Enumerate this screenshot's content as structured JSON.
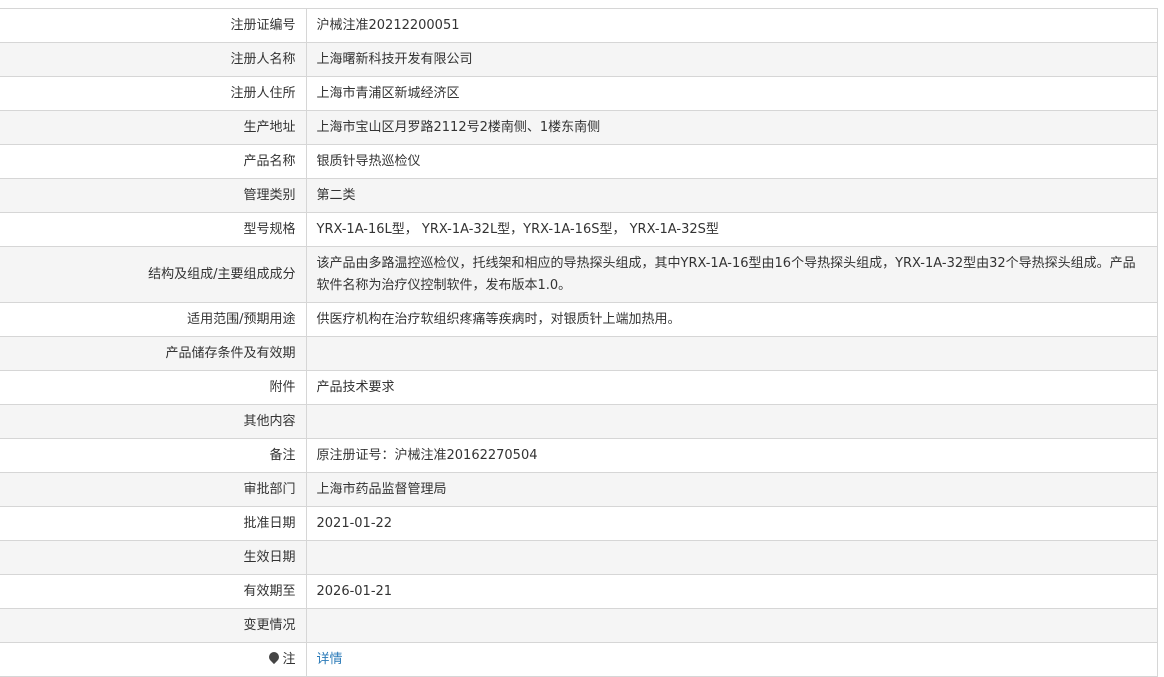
{
  "rows": [
    {
      "label": "注册证编号",
      "value": "沪械注准20212200051"
    },
    {
      "label": "注册人名称",
      "value": "上海曙新科技开发有限公司"
    },
    {
      "label": "注册人住所",
      "value": "上海市青浦区新城经济区"
    },
    {
      "label": "生产地址",
      "value": "上海市宝山区月罗路2112号2楼南侧、1楼东南侧"
    },
    {
      "label": "产品名称",
      "value": "银质针导热巡检仪"
    },
    {
      "label": "管理类别",
      "value": "第二类"
    },
    {
      "label": "型号规格",
      "value": "YRX-1A-16L型， YRX-1A-32L型，YRX-1A-16S型， YRX-1A-32S型"
    },
    {
      "label": "结构及组成/主要组成成分",
      "value": "该产品由多路温控巡检仪，托线架和相应的导热探头组成，其中YRX-1A-16型由16个导热探头组成，YRX-1A-32型由32个导热探头组成。产品软件名称为治疗仪控制软件，发布版本1.0。"
    },
    {
      "label": "适用范围/预期用途",
      "value": "供医疗机构在治疗软组织疼痛等疾病时，对银质针上端加热用。"
    },
    {
      "label": "产品储存条件及有效期",
      "value": ""
    },
    {
      "label": "附件",
      "value": "产品技术要求"
    },
    {
      "label": "其他内容",
      "value": ""
    },
    {
      "label": "备注",
      "value": "原注册证号：沪械注准20162270504"
    },
    {
      "label": "审批部门",
      "value": "上海市药品监督管理局"
    },
    {
      "label": "批准日期",
      "value": "2021-01-22"
    },
    {
      "label": "生效日期",
      "value": ""
    },
    {
      "label": "有效期至",
      "value": "2026-01-21"
    },
    {
      "label": "变更情况",
      "value": ""
    }
  ],
  "note": {
    "label": "注",
    "icon": "pin-icon",
    "link_text": "详情"
  },
  "colors": {
    "border": "#d6d6d6",
    "row_alt": "#f5f5f5",
    "text": "#333333",
    "link": "#2a7ab8"
  }
}
